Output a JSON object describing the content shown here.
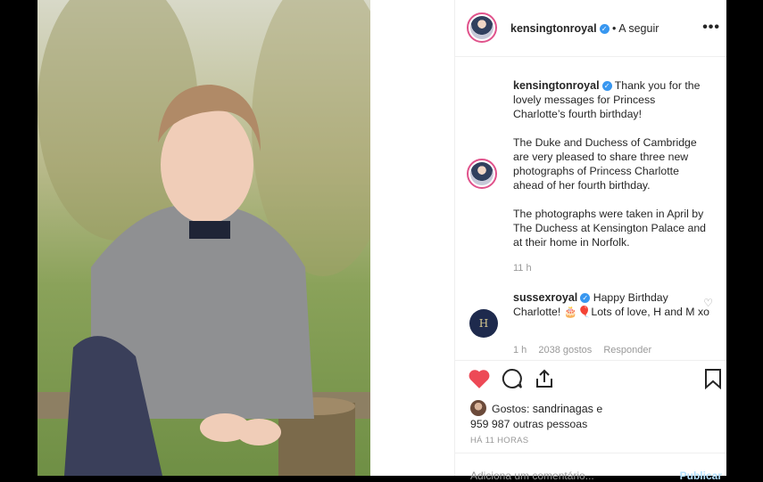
{
  "header": {
    "username": "kensingtonroyal",
    "follow_label": "A seguir",
    "separator": "•"
  },
  "caption": {
    "username": "kensingtonroyal",
    "paragraphs": [
      "Thank you for the lovely messages for Princess Charlotte’s fourth birthday!",
      "The Duke and Duchess of Cambridge are very pleased to share three new photographs of Princess Charlotte ahead of her fourth birthday.",
      "The photographs were taken in April by The Duchess at Kensington Palace and at their home in Norfolk."
    ],
    "time": "11 h"
  },
  "comment": {
    "username": "sussexroyal",
    "text": "Happy Birthday Charlotte! 🎂🎈Lots of love, H and M xo",
    "time": "1 h",
    "likes": "2038 gostos",
    "reply_label": "Responder",
    "avatar_text": "H"
  },
  "likes": {
    "prefix": "Gostos: ",
    "user": "sandrinagas",
    "conjunction": " e",
    "others": "959 987 outras pessoas"
  },
  "timestamp": "HÁ 11 HORAS",
  "add_comment_placeholder": "Adiciona um comentário...",
  "publish_label": "Publicar",
  "colors": {
    "heart": "#ed4956",
    "verified": "#3897f0",
    "muted": "#999999"
  },
  "icons": [
    "more-options-icon",
    "verified-icon",
    "heart-icon",
    "comment-icon",
    "share-icon",
    "bookmark-icon"
  ]
}
